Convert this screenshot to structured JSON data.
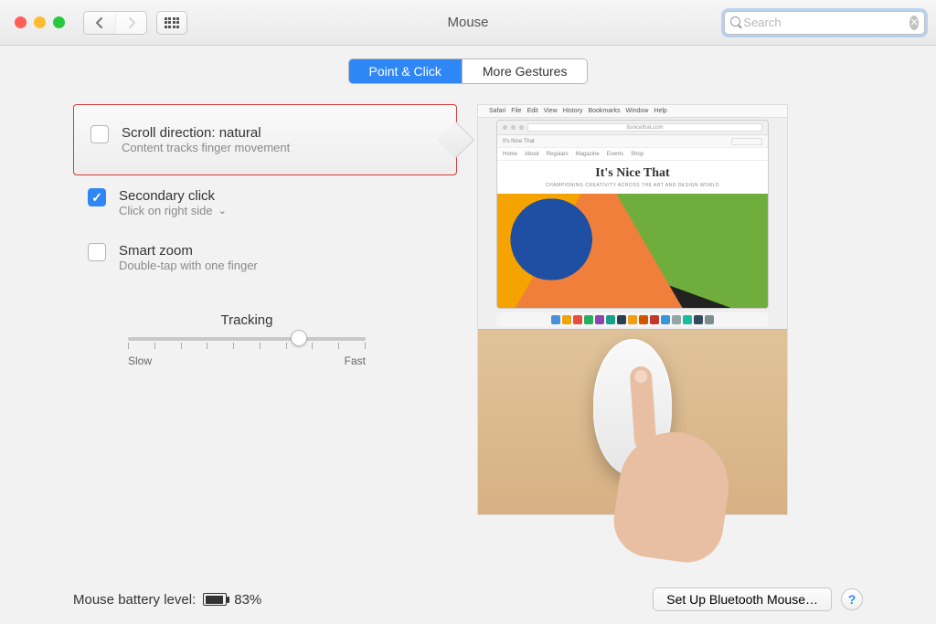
{
  "window": {
    "title": "Mouse"
  },
  "search": {
    "placeholder": "Search"
  },
  "tabs": {
    "point_click": "Point & Click",
    "more_gestures": "More Gestures",
    "active": "point_click"
  },
  "options": {
    "scroll_direction": {
      "title": "Scroll direction: natural",
      "subtitle": "Content tracks finger movement",
      "checked": false
    },
    "secondary_click": {
      "title": "Secondary click",
      "subtitle": "Click on right side",
      "checked": true,
      "has_menu": true
    },
    "smart_zoom": {
      "title": "Smart zoom",
      "subtitle": "Double-tap with one finger",
      "checked": false
    }
  },
  "tracking": {
    "label": "Tracking",
    "slow": "Slow",
    "fast": "Fast",
    "value_pct": 72,
    "ticks": 10
  },
  "preview": {
    "site_title": "It's Nice That",
    "site_sub": "CHAMPIONING CREATIVITY ACROSS THE ART AND DESIGN WORLD",
    "nav": [
      "Home",
      "About",
      "Regulars",
      "Magazine",
      "Events",
      "Shop"
    ],
    "brand": "It's Nice That",
    "menubar": [
      "File",
      "Edit",
      "View",
      "History",
      "Bookmarks",
      "Window",
      "Help"
    ],
    "browser": "Safari"
  },
  "footer": {
    "battery_label": "Mouse battery level:",
    "battery_pct": "83%",
    "bluetooth_btn": "Set Up Bluetooth Mouse…",
    "help": "?"
  }
}
